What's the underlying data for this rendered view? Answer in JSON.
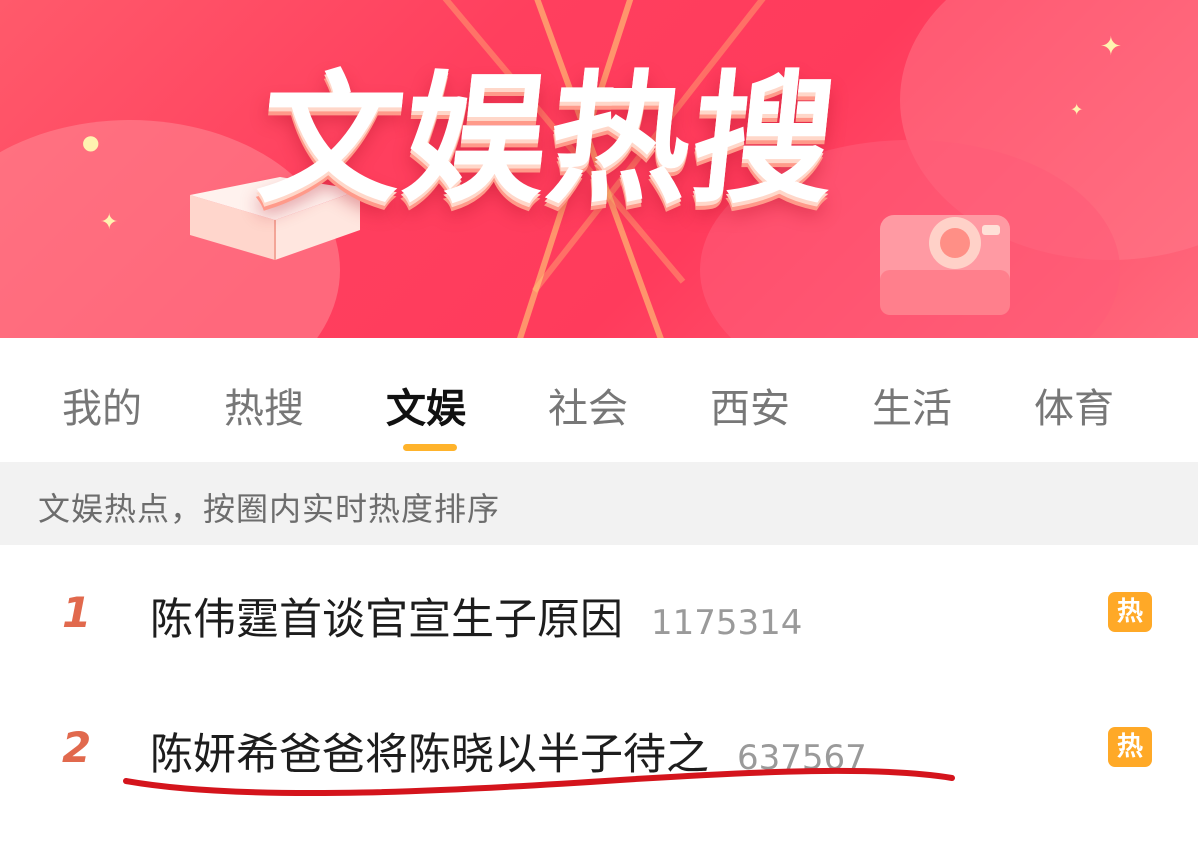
{
  "banner": {
    "title": "文娱热搜"
  },
  "tabs": [
    {
      "label": "我的",
      "active": false
    },
    {
      "label": "热搜",
      "active": false
    },
    {
      "label": "文娱",
      "active": true
    },
    {
      "label": "社会",
      "active": false
    },
    {
      "label": "西安",
      "active": false
    },
    {
      "label": "生活",
      "active": false
    },
    {
      "label": "体育",
      "active": false
    }
  ],
  "hint": "文娱热点，按圈内实时热度排序",
  "list": [
    {
      "rank": "1",
      "title": "陈伟霆首谈官宣生子原因",
      "count": "1175314",
      "badge": "热"
    },
    {
      "rank": "2",
      "title": "陈妍希爸爸将陈晓以半子待之",
      "count": "637567",
      "badge": "热"
    }
  ],
  "colors": {
    "banner": "#ff3f5e",
    "tab_active_underline": "#ffb32b",
    "rank": "#e1694d",
    "hot_badge": "#ffa927",
    "annotation": "#d4141c"
  }
}
